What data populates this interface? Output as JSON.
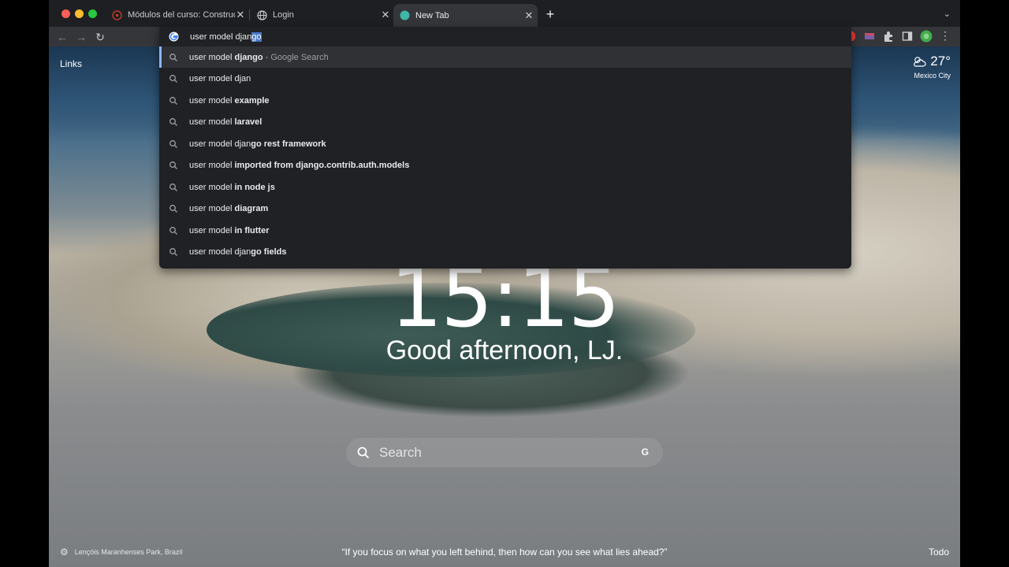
{
  "browser": {
    "tabs": [
      {
        "title": "Módulos del curso: Construcci",
        "active": false
      },
      {
        "title": "Login",
        "active": false
      },
      {
        "title": "New Tab",
        "active": true
      }
    ],
    "omnibox": {
      "typed": "user model djan",
      "autocomplete": "go"
    }
  },
  "suggestions": [
    {
      "prefix": "user model ",
      "bold": "django",
      "plain_after": "",
      "hint": " - Google Search",
      "highlighted": true
    },
    {
      "prefix": "user model djan",
      "bold": "",
      "plain_after": "",
      "hint": "",
      "highlighted": false
    },
    {
      "prefix": "user model ",
      "bold": "example",
      "plain_after": "",
      "hint": "",
      "highlighted": false
    },
    {
      "prefix": "user model ",
      "bold": "laravel",
      "plain_after": "",
      "hint": "",
      "highlighted": false
    },
    {
      "prefix": "user model djan",
      "bold": "go rest framework",
      "plain_after": "",
      "hint": "",
      "highlighted": false
    },
    {
      "prefix": "user model ",
      "bold": "imported from django.contrib.auth.models",
      "plain_after": "",
      "hint": "",
      "highlighted": false
    },
    {
      "prefix": "user model ",
      "bold": "in node js",
      "plain_after": "",
      "hint": "",
      "highlighted": false
    },
    {
      "prefix": "user model ",
      "bold": "diagram",
      "plain_after": "",
      "hint": "",
      "highlighted": false
    },
    {
      "prefix": "user model ",
      "bold": "in flutter",
      "plain_after": "",
      "hint": "",
      "highlighted": false
    },
    {
      "prefix": "user model djan",
      "bold": "go fields",
      "plain_after": "",
      "hint": "",
      "highlighted": false
    }
  ],
  "newtab": {
    "links_label": "Links",
    "weather_temp": "27°",
    "weather_city": "Mexico City",
    "weather_icon": "partly-cloudy-icon",
    "clock": "15:15",
    "greeting": "Good afternoon, LJ.",
    "search_placeholder": "Search",
    "search_engine_letter": "G",
    "location": "Lençóis Maranhenses Park, Brazil",
    "quote": "“If you focus on what you left behind, then how can you see what lies ahead?”",
    "todo_label": "Todo"
  },
  "colors": {
    "accent_blue": "#8ab4f8",
    "selection": "#4a78c4",
    "omnibox_bg": "#202124"
  }
}
